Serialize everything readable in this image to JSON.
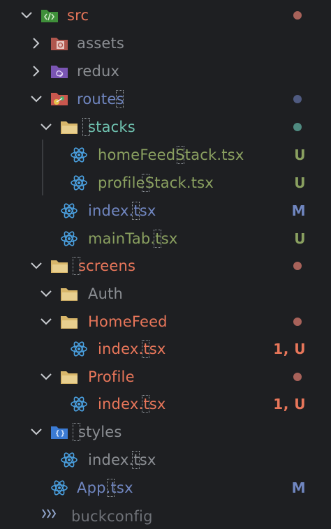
{
  "colors": {
    "background": "#1e1f22",
    "untracked": "#8aa060",
    "modified": "#7086c0",
    "error": "#e8765a",
    "dim": "#8a8d92",
    "teal": "#6fc2b0",
    "plain": "#a7aab0",
    "dot_error": "#a8625a",
    "dot_modified": "#4f5a80",
    "dot_untracked": "#4f8a80"
  },
  "tree": {
    "src": {
      "label": "src",
      "icon": "folder-src-icon"
    },
    "assets": {
      "label": "assets",
      "icon": "folder-assets-icon"
    },
    "redux": {
      "label": "redux",
      "icon": "folder-redux-icon"
    },
    "routes": {
      "label": "routes",
      "icon": "folder-routes-icon"
    },
    "stacks": {
      "label": "stacks",
      "icon": "folder-icon"
    },
    "homeFeedStack": {
      "label": "homeFeedStack.tsx",
      "badge": "U",
      "icon": "react-icon"
    },
    "profileStack": {
      "label": "profileStack.tsx",
      "badge": "U",
      "icon": "react-icon"
    },
    "routes_index": {
      "label": "index.tsx",
      "badge": "M",
      "icon": "react-icon"
    },
    "mainTab": {
      "label": "mainTab.tsx",
      "badge": "U",
      "icon": "react-icon"
    },
    "screens": {
      "label": "screens",
      "icon": "folder-icon"
    },
    "auth": {
      "label": "Auth",
      "icon": "folder-icon"
    },
    "homefeed": {
      "label": "HomeFeed",
      "icon": "folder-icon"
    },
    "homefeed_index": {
      "label": "index.tsx",
      "badge": "1, U",
      "icon": "react-icon"
    },
    "profile": {
      "label": "Profile",
      "icon": "folder-icon"
    },
    "profile_index": {
      "label": "index.tsx",
      "badge": "1, U",
      "icon": "react-icon"
    },
    "styles": {
      "label": "styles",
      "icon": "folder-styles-icon"
    },
    "styles_index": {
      "label": "index.tsx",
      "icon": "react-icon"
    },
    "app": {
      "label": "App.tsx",
      "badge": "M",
      "icon": "react-icon"
    },
    "buckconfig": {
      "label": "buckconfig",
      "icon": "config-icon"
    }
  }
}
